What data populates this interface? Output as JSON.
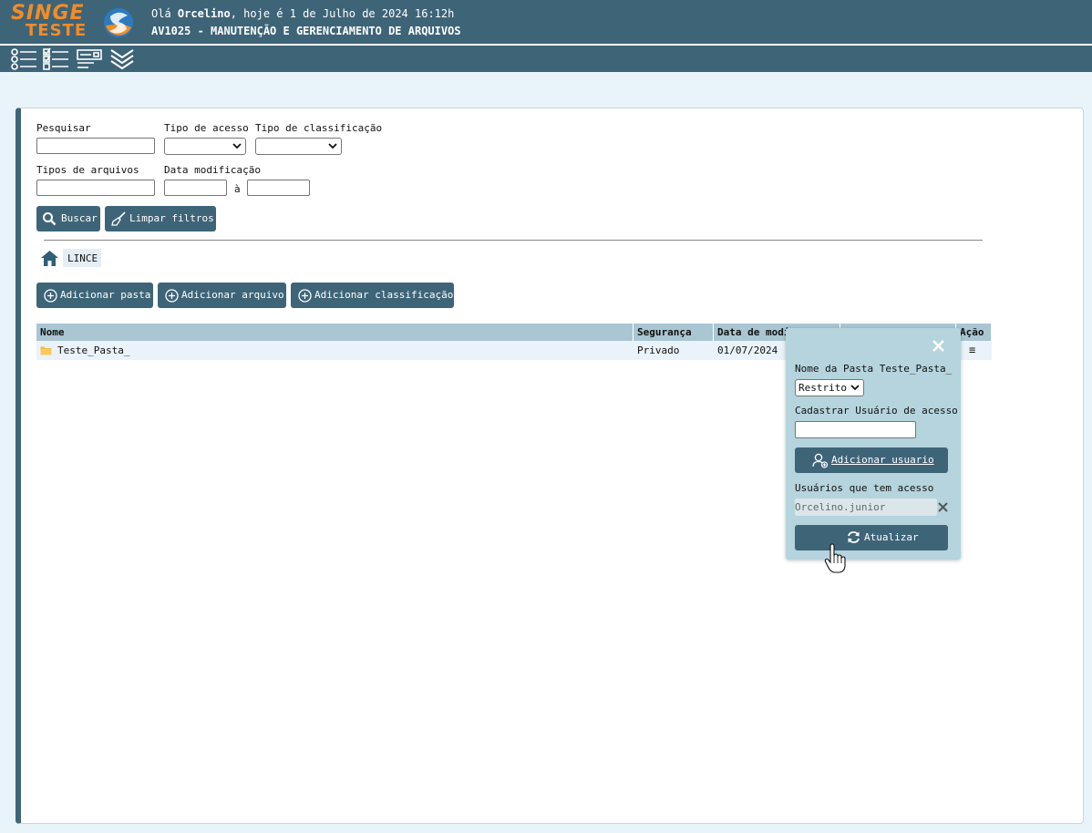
{
  "header": {
    "logo_line1": "SINGE",
    "logo_line2": "TESTE",
    "greeting_prefix": "Olá ",
    "user_name": "Orcelino",
    "greeting_suffix": ", hoje é 1 de Julho de 2024 16:12h",
    "page_title": "AV1025 - MANUTENÇÃO E GERENCIAMENTO DE ARQUIVOS"
  },
  "toolbar": {
    "icons": [
      "list-icon",
      "checklist-icon",
      "form-icon",
      "collapse-chevrons-icon"
    ]
  },
  "filters": {
    "search_label": "Pesquisar",
    "access_type_label": "Tipo de acesso",
    "classification_type_label": "Tipo de classificação",
    "file_types_label": "Tipos de arquivos",
    "modified_date_label": "Data modificação",
    "date_separator": "à",
    "search_button": "Buscar",
    "clear_button": "Limpar filtros"
  },
  "breadcrumb": {
    "home_icon": "home-icon",
    "current": "LINCE"
  },
  "actions": {
    "add_folder": "Adicionar pasta",
    "add_file": "Adicionar arquivo",
    "add_classification": "Adicionar classificação"
  },
  "table": {
    "columns": {
      "name": "Nome",
      "security": "Segurança",
      "modified": "Data de modi",
      "action": "Ação"
    },
    "rows": [
      {
        "name": "Teste_Pasta_",
        "security": "Privado",
        "modified": "01/07/2024",
        "action": "≡"
      }
    ]
  },
  "popup": {
    "folder_name_label": "Nome da Pasta Teste_Pasta_",
    "access_select_value": "Restrito",
    "register_user_label": "Cadastrar Usuário de acesso",
    "add_user_button": "Adicionar usuario",
    "users_with_access_label": "Usuários que tem acesso",
    "users": [
      "Orcelino.junior"
    ],
    "update_button": "Atualizar"
  },
  "colors": {
    "header_bg": "#3e6478",
    "logo_orange": "#f28c28",
    "button_bg": "#3e6478",
    "table_header_bg": "#a9c6d2",
    "popup_bg": "#b5d4de",
    "page_bg": "#e8f3fa"
  }
}
